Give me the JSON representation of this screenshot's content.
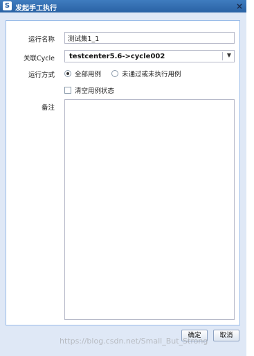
{
  "window": {
    "title": "发起手工执行",
    "close_glyph": "×"
  },
  "form": {
    "run_name": {
      "label": "运行名称",
      "value": "测试集1_1"
    },
    "cycle": {
      "label": "关联Cycle",
      "value": "testcenter5.6->cycle002"
    },
    "run_mode": {
      "label": "运行方式",
      "options": [
        {
          "label": "全部用例",
          "checked": true
        },
        {
          "label": "未通过或未执行用例",
          "checked": false
        }
      ]
    },
    "clear_status": {
      "label": "清空用例状态",
      "checked": false
    },
    "notes": {
      "label": "备注",
      "value": ""
    }
  },
  "buttons": {
    "confirm": "确定",
    "cancel": "取消"
  },
  "watermark": "https://blog.csdn.net/Small_But_Strong",
  "colors": {
    "titlebar": "#2a62a4",
    "dialog_bg": "#dfe8f6",
    "border": "#99bbe8"
  }
}
